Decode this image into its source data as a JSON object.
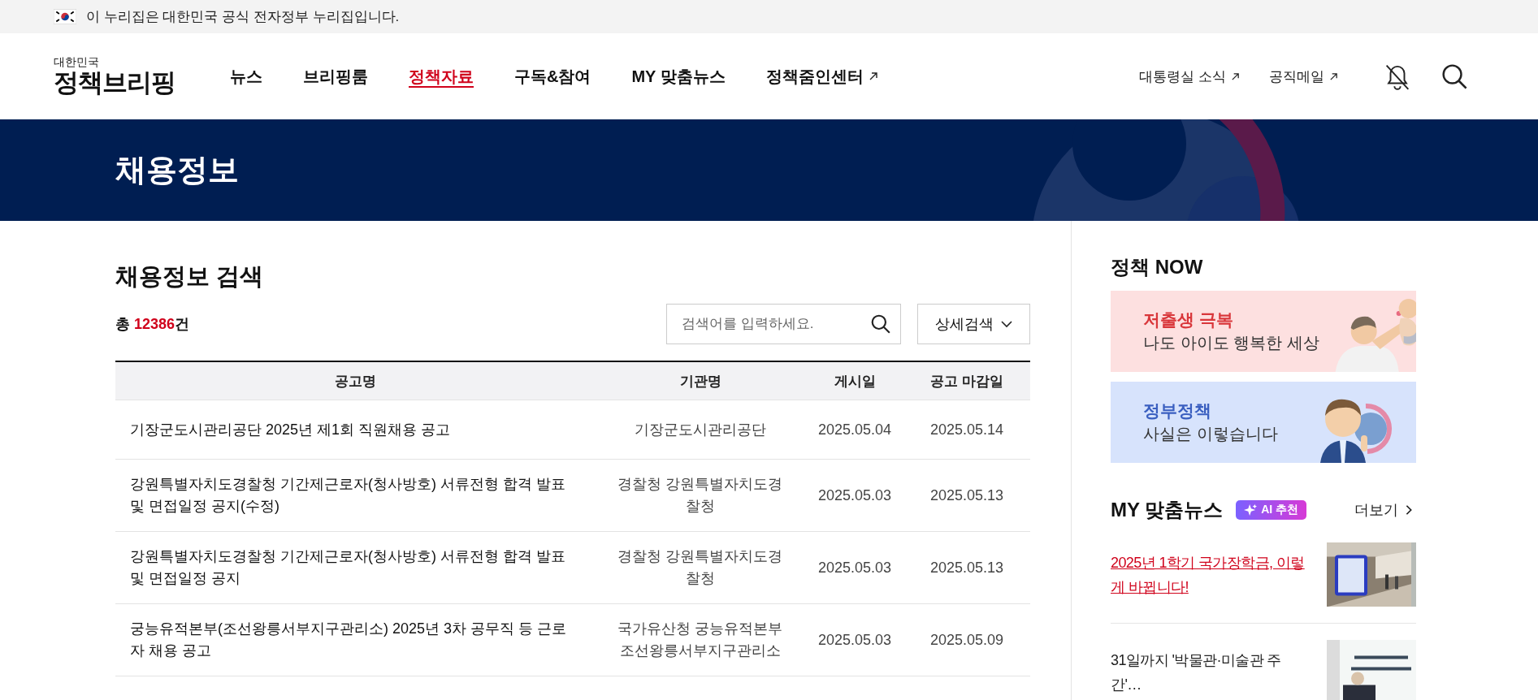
{
  "gov_bar": {
    "text": "이 누리집은 대한민국 공식 전자정부 누리집입니다."
  },
  "header": {
    "logo": {
      "subtitle": "대한민국",
      "title": "정책브리핑"
    },
    "nav": [
      {
        "label": "뉴스",
        "selected": false,
        "external": false
      },
      {
        "label": "브리핑룸",
        "selected": false,
        "external": false
      },
      {
        "label": "정책자료",
        "selected": true,
        "external": false
      },
      {
        "label": "구독&참여",
        "selected": false,
        "external": false
      },
      {
        "label": "MY 맞춤뉴스",
        "selected": false,
        "external": false
      },
      {
        "label": "정책줌인센터",
        "selected": false,
        "external": true
      }
    ],
    "utility_links": [
      {
        "label": "대통령실 소식",
        "external": true
      },
      {
        "label": "공직메일",
        "external": true
      }
    ]
  },
  "page_banner": {
    "title": "채용정보"
  },
  "search_section": {
    "title": "채용정보 검색",
    "total": {
      "prefix": "총",
      "count": "12386",
      "suffix": "건"
    },
    "search_field": {
      "placeholder": "검색어를 입력하세요."
    },
    "detail_button": "상세검색"
  },
  "table": {
    "columns": [
      "공고명",
      "기관명",
      "게시일",
      "공고 마감일"
    ],
    "rows": [
      {
        "title": "기장군도시관리공단 2025년 제1회 직원채용 공고",
        "agency": "기장군도시관리공단",
        "posted": "2025.05.04",
        "deadline": "2025.05.14"
      },
      {
        "title": "강원특별자치도경찰청 기간제근로자(청사방호) 서류전형 합격 발표 및 면접일정 공지(수정)",
        "agency": "경찰청 강원특별자치도경찰청",
        "posted": "2025.05.03",
        "deadline": "2025.05.13"
      },
      {
        "title": "강원특별자치도경찰청 기간제근로자(청사방호) 서류전형 합격 발표 및 면접일정 공지",
        "agency": "경찰청 강원특별자치도경찰청",
        "posted": "2025.05.03",
        "deadline": "2025.05.13"
      },
      {
        "title": "궁능유적본부(조선왕릉서부지구관리소) 2025년 3차 공무직 등 근로자 채용 공고",
        "agency": "국가유산청 궁능유적본부 조선왕릉서부지구관리소",
        "posted": "2025.05.03",
        "deadline": "2025.05.09"
      }
    ]
  },
  "sidebar": {
    "policy_now": {
      "title": "정책 NOW",
      "banners": [
        {
          "kind": "family",
          "headline": "저출생 극복",
          "subline": "나도 아이도 행복한 세상"
        },
        {
          "kind": "official",
          "headline": "정부정책",
          "subline": "사실은 이렇습니다"
        }
      ]
    },
    "my_news": {
      "title": "MY 맞춤뉴스",
      "badge": "AI 추천",
      "more": "더보기",
      "items": [
        {
          "title": "2025년 1학기 국가장학금, 이렇게 바뀝니다!",
          "highlighted": true
        },
        {
          "title": "31일까지 '박물관·미술관 주간'…",
          "highlighted": false
        }
      ]
    }
  }
}
